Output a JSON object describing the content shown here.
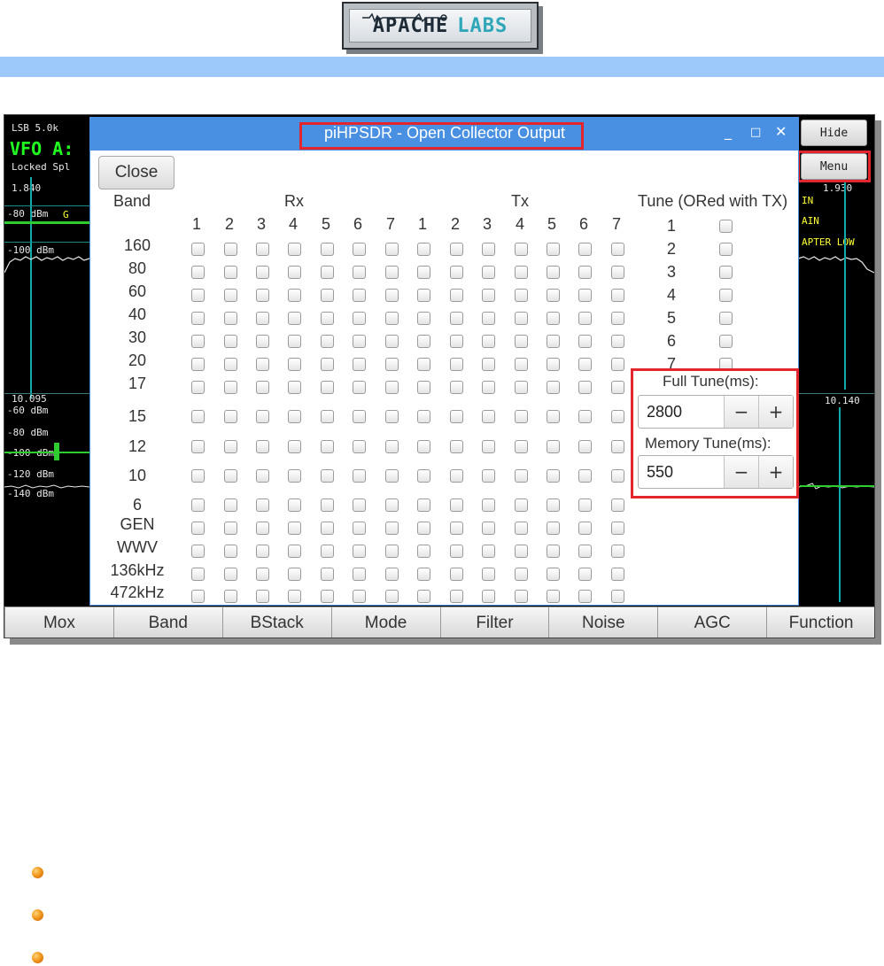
{
  "header": {
    "logo_text_1": "APACHE",
    "logo_text_2": "LABS"
  },
  "radio": {
    "mode_line": "LSB 5.0k",
    "vfo_label": "VFO A:",
    "status_line": "Locked Spl",
    "freq_left": "1.840",
    "dbm_80": "-80 dBm",
    "dbm_100": "-100 dBm",
    "freq_right": "1.930",
    "right_label_1": "IN",
    "right_label_2": "AIN",
    "right_label_3": "APTER LOW",
    "freq_left_2": "10.095",
    "dbm_60b": "-60 dBm",
    "dbm_80b": "-80 dBm",
    "dbm_100b": "-100 dBm",
    "dbm_120b": "-120 dBm",
    "dbm_140b": "-140 dBm",
    "freq_right_2": "10.140",
    "marker": "G"
  },
  "side_buttons": {
    "hide": "Hide",
    "menu": "Menu"
  },
  "dialog": {
    "title": "piHPSDR - Open Collector Output",
    "close_label": "Close",
    "band_header": "Band",
    "rx_header": "Rx",
    "tx_header": "Tx",
    "tune_header": "Tune (ORed with TX)",
    "column_numbers": [
      "1",
      "2",
      "3",
      "4",
      "5",
      "6",
      "7"
    ],
    "bands": [
      "160",
      "80",
      "60",
      "40",
      "30",
      "20",
      "17",
      "15",
      "12",
      "10",
      "6",
      "GEN",
      "WWV",
      "136kHz",
      "472kHz"
    ],
    "tune_numbers": [
      "1",
      "2",
      "3",
      "4",
      "5",
      "6",
      "7"
    ],
    "full_tune_label": "Full Tune(ms):",
    "full_tune_value": "2800",
    "memory_tune_label": "Memory Tune(ms):",
    "memory_tune_value": "550",
    "minus": "−",
    "plus": "+"
  },
  "toolbar": [
    "Mox",
    "Band",
    "BStack",
    "Mode",
    "Filter",
    "Noise",
    "AGC",
    "Function"
  ],
  "colors": {
    "dialog_title_bar": "#4a90e2",
    "highlight": "#e3262e",
    "band_stripe": "#9cc8fa"
  }
}
